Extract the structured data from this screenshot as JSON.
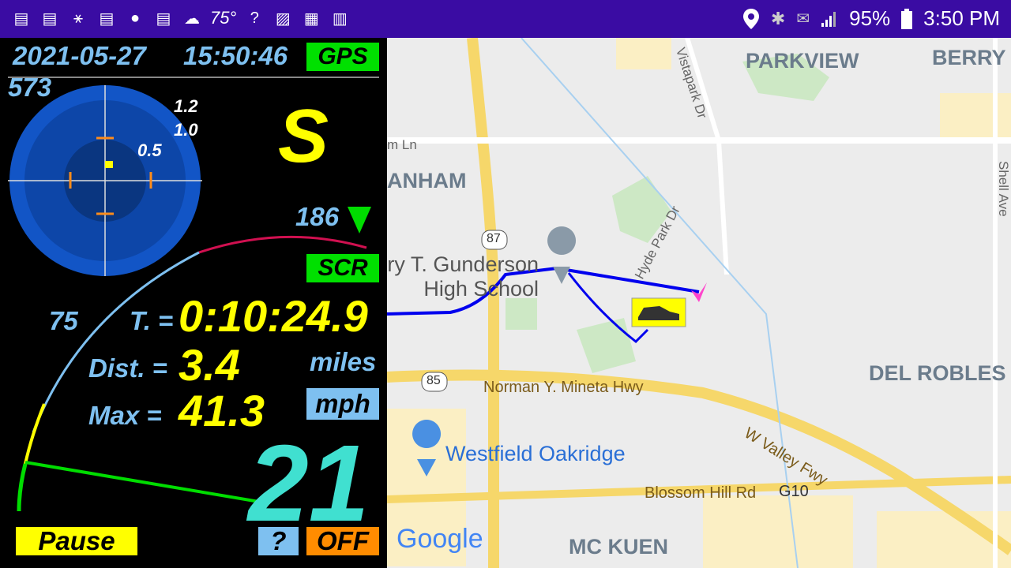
{
  "statusbar": {
    "left_icons": [
      "news-icon",
      "news-icon",
      "satellite-icon",
      "news-icon",
      "spotify-icon",
      "news-icon",
      "cloud-icon",
      "temperature",
      "help-icon",
      "image-icon",
      "calendar-icon",
      "chart-icon"
    ],
    "temperature": "75°",
    "battery": "95%",
    "time": "3:50 PM"
  },
  "panel": {
    "date": "2021-05-27",
    "time": "15:50:46",
    "gps_label": "GPS",
    "altitude": "573",
    "radar_labels": {
      "r1_2": "1.2",
      "r1_0": "1.0",
      "r0_5": "0.5"
    },
    "heading_letter": "S",
    "heading_degrees": "186",
    "scr_label": "SCR",
    "gauge_mark": "75",
    "time_label": "T. =",
    "time_value": "0:10:24.9",
    "dist_label": "Dist. =",
    "dist_value": "3.4",
    "dist_unit": "miles",
    "max_label": "Max =",
    "max_value": "41.3",
    "speed_unit": "mph",
    "speed": "21",
    "pause_button": "Pause",
    "help_button": "?",
    "off_button": "OFF"
  },
  "colors": {
    "status_bar": "#3a0ca3",
    "gps_badge": "#00e000",
    "text_blue": "#7ec0f0",
    "text_yellow": "#ffff00",
    "speed": "#40e0d0",
    "off": "#ff8c00",
    "route": "#0000ee"
  },
  "map": {
    "labels": {
      "parkview": "PARKVIEW",
      "berry": "BERRY F",
      "anham": "ANHAM",
      "del_robles": "DEL ROBLES",
      "mc_kuen": "MC KUEN",
      "school": "ry T. Gunderson\nHigh School",
      "norman": "Norman Y. Mineta Hwy",
      "valley": "W Valley Fwy",
      "westfield": "Westfield Oakridge",
      "blossom": "Blossom Hill Rd",
      "g10": "G10",
      "r87": "87",
      "r85": "85",
      "vistapark": "Vistapark Dr",
      "hyde": "Hyde Park Dr",
      "shell": "Shell Ave",
      "ln": "m Ln",
      "google": "Google"
    }
  }
}
